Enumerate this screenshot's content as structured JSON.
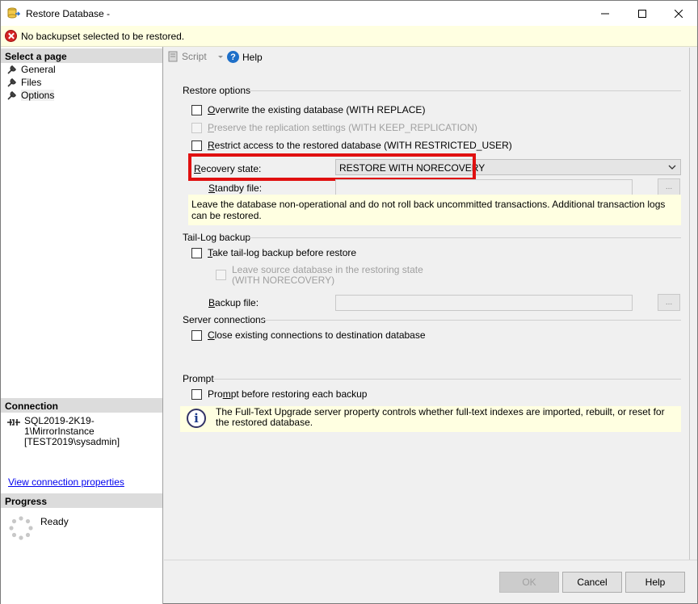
{
  "window": {
    "title": "Restore Database -",
    "minimize_icon": "minimize-icon",
    "maximize_icon": "maximize-icon",
    "close_icon": "close-icon"
  },
  "infobar": {
    "message": "No backupset selected to be restored."
  },
  "sidebar": {
    "select_page_header": "Select a page",
    "pages": [
      {
        "label": "General",
        "selected": false
      },
      {
        "label": "Files",
        "selected": false
      },
      {
        "label": "Options",
        "selected": true
      }
    ],
    "connection_header": "Connection",
    "connection_server": "SQL2019-2K19-1\\MirrorInstance",
    "connection_user": "[TEST2019\\sysadmin]",
    "view_connection_link": "View connection properties",
    "progress_header": "Progress",
    "progress_status": "Ready"
  },
  "toolbar": {
    "script_label": "Script",
    "help_label": "Help"
  },
  "restore_options": {
    "title": "Restore options",
    "overwrite": {
      "label_u": "O",
      "label_rest": "verwrite the existing database (WITH REPLACE)",
      "checked": false,
      "enabled": true
    },
    "preserve": {
      "label_u": "P",
      "label_rest": "reserve the replication settings (WITH KEEP_REPLICATION)",
      "checked": false,
      "enabled": false
    },
    "restrict": {
      "label_u": "R",
      "label_rest": "estrict access to the restored database (WITH RESTRICTED_USER)",
      "checked": false,
      "enabled": true
    },
    "recovery_label_u": "R",
    "recovery_label_rest": "ecovery state:",
    "recovery_value": "RESTORE WITH NORECOVERY",
    "standby_label_u": "S",
    "standby_label_rest": "tandby file:",
    "standby_value": "",
    "browse_label": "...",
    "hint": "Leave the database non-operational and do not roll back uncommitted transactions. Additional transaction logs can be restored."
  },
  "tail_log": {
    "title": "Tail-Log backup",
    "take_tail": {
      "label_u": "T",
      "label_rest": "ake tail-log backup before restore",
      "checked": false
    },
    "leave_source_line1": "Leave source database in the restoring state",
    "leave_source_line2": "(WITH NORECOVERY)",
    "backup_file_label_u": "B",
    "backup_file_label_rest": "ackup file:",
    "browse_label": "..."
  },
  "server_connections": {
    "title": "Server connections",
    "close_existing": {
      "label_u": "C",
      "label_rest": "lose existing connections to destination database",
      "checked": false
    }
  },
  "prompt": {
    "title": "Prompt",
    "prompt_before": {
      "label_pre": "Pro",
      "label_u": "m",
      "label_rest": "pt before restoring each backup",
      "checked": false
    },
    "info": "The Full-Text Upgrade server property controls whether full-text indexes are imported, rebuilt, or reset for the restored database."
  },
  "footer": {
    "ok_label": "OK",
    "cancel_label": "Cancel",
    "help_label": "Help"
  },
  "colors": {
    "highlight_border": "#e01010",
    "info_bg": "#ffffe1",
    "link": "#0000ee"
  }
}
